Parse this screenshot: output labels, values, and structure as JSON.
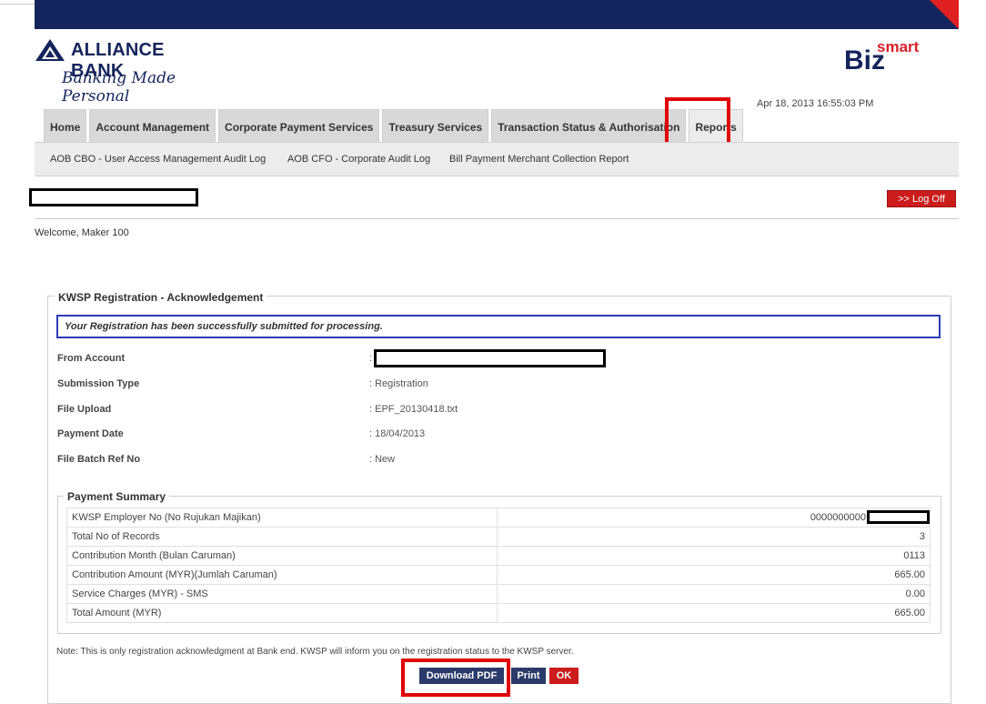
{
  "header": {
    "bank_name": "ALLIANCE BANK",
    "tagline": "Banking Made Personal",
    "product_main": "Biz",
    "product_sup": "smart",
    "datetime": "Apr 18, 2013 16:55:03 PM"
  },
  "tabs": [
    {
      "label": "Home"
    },
    {
      "label": "Account Management"
    },
    {
      "label": "Corporate Payment Services"
    },
    {
      "label": "Treasury Services"
    },
    {
      "label": "Transaction Status & Authorisation"
    },
    {
      "label": "Reports",
      "active": true
    }
  ],
  "subnav": [
    {
      "label": "AOB CBO - User Access Management Audit Log"
    },
    {
      "label": "AOB CFO - Corporate Audit Log"
    },
    {
      "label": "Bill Payment Merchant Collection Report"
    }
  ],
  "user": {
    "logoff_label": ">> Log Off",
    "welcome": "Welcome, Maker 100"
  },
  "ack": {
    "title": "KWSP Registration - Acknowledgement",
    "message": "Your Registration has been successfully submitted for processing.",
    "fields": [
      {
        "label": "From Account",
        "value": ":"
      },
      {
        "label": "Submission Type",
        "value": ": Registration"
      },
      {
        "label": "File Upload",
        "value": ": EPF_20130418.txt"
      },
      {
        "label": "Payment Date",
        "value": ": 18/04/2013"
      },
      {
        "label": "File Batch Ref No",
        "value": ": New"
      }
    ]
  },
  "summary": {
    "title": "Payment Summary",
    "rows": [
      {
        "label": "KWSP Employer No (No Rujukan Majikan)",
        "value": "0000000000"
      },
      {
        "label": "Total No of Records",
        "value": "3"
      },
      {
        "label": "Contribution Month (Bulan Caruman)",
        "value": "0113"
      },
      {
        "label": "Contribution Amount (MYR)(Jumlah Caruman)",
        "value": "665.00"
      },
      {
        "label": "Service Charges (MYR) - SMS",
        "value": "0.00"
      },
      {
        "label": "Total Amount (MYR)",
        "value": "665.00"
      }
    ]
  },
  "note": "Note: This is only registration acknowledgment at Bank end. KWSP will inform you on the registration status to the KWSP server.",
  "buttons": {
    "download_pdf": "Download PDF",
    "print": "Print",
    "ok": "OK"
  },
  "colors": {
    "navy": "#14245c",
    "brand_red": "#d6202a",
    "highlight_red": "#e00000",
    "message_border": "#2b3bb5"
  }
}
